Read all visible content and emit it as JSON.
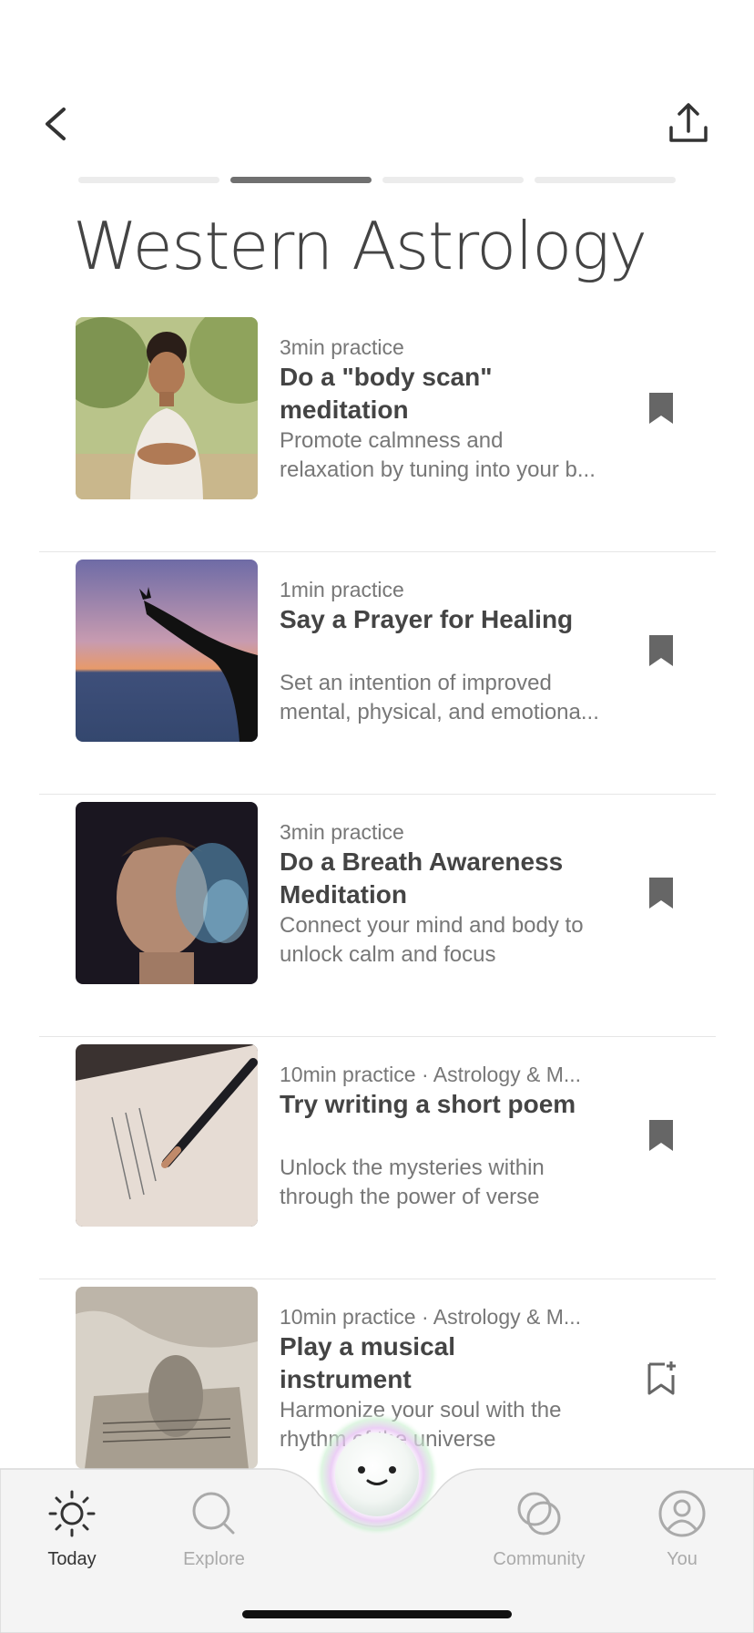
{
  "header": {
    "title": "Western Astrology",
    "back_icon": "chevron-left-icon",
    "share_icon": "share-upload-icon",
    "progress_segments": 4,
    "active_segment": 2
  },
  "items": [
    {
      "meta": "3min practice",
      "title": "Do a \"body scan\" meditation",
      "desc_line1": "Promote calmness and",
      "desc_line2": "relaxation by tuning into your b...",
      "bookmarked": true
    },
    {
      "meta": "1min practice",
      "title": "Say a Prayer for Healing",
      "desc_line1": "Set an intention of improved",
      "desc_line2": "mental, physical, and emotiona...",
      "bookmarked": true
    },
    {
      "meta": "3min practice",
      "title": "Do a Breath Awareness Meditation",
      "desc_line1": "Connect your mind and body to",
      "desc_line2": "unlock calm and focus",
      "bookmarked": true
    },
    {
      "meta": "10min practice · Astrology & M...",
      "title": "Try writing a short poem",
      "desc_line1": "Unlock the mysteries within",
      "desc_line2": "through the power of verse",
      "bookmarked": true
    },
    {
      "meta": "10min practice · Astrology & M...",
      "title": "Play a musical instrument",
      "desc_line1": "Harmonize your soul with the",
      "desc_line2": "rhythm of the universe",
      "bookmarked": false
    }
  ],
  "tabs": [
    {
      "label": "Today",
      "icon": "sun-icon",
      "active": true
    },
    {
      "label": "Explore",
      "icon": "search-icon",
      "active": false
    },
    {
      "label": "Community",
      "icon": "community-circles-icon",
      "active": false
    },
    {
      "label": "You",
      "icon": "profile-icon",
      "active": false
    }
  ],
  "colors": {
    "accent_active": "#707070",
    "text_primary": "#444444",
    "text_secondary": "#777777",
    "tab_inactive": "#aaaaaa"
  }
}
